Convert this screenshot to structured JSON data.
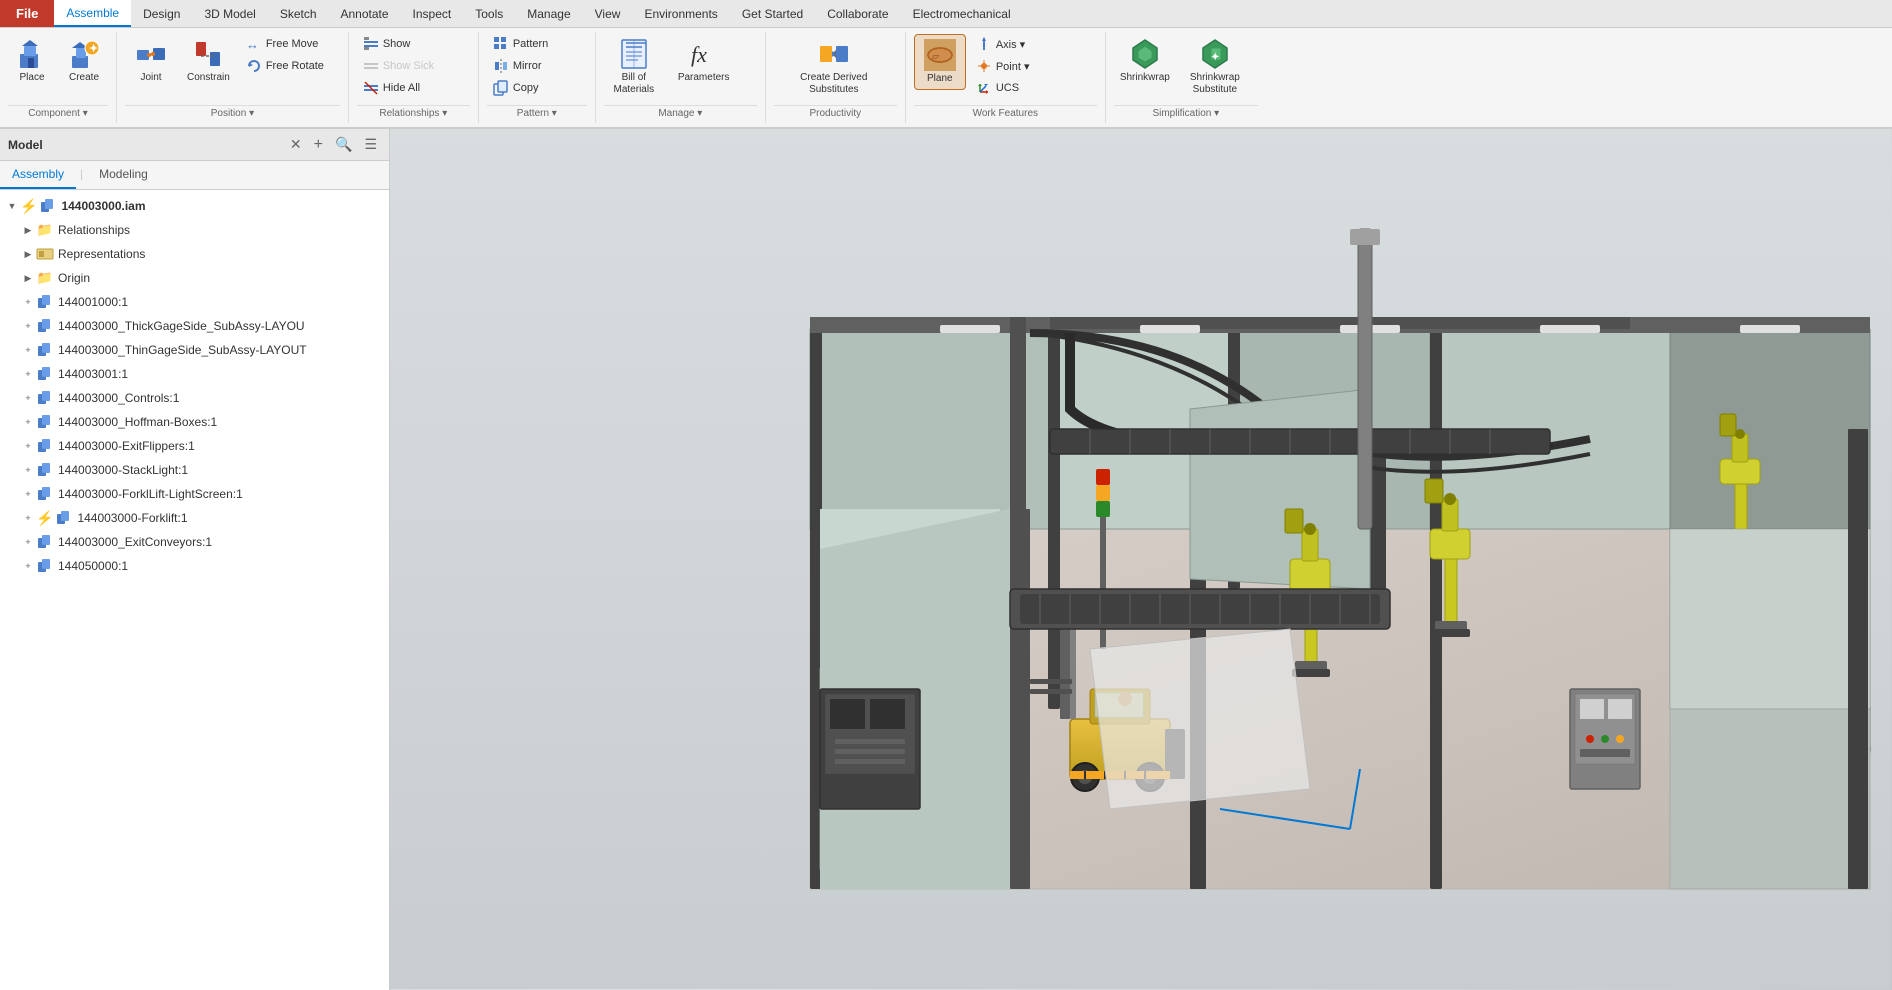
{
  "menubar": {
    "file": "File",
    "tabs": [
      "Assemble",
      "Design",
      "3D Model",
      "Sketch",
      "Annotate",
      "Inspect",
      "Tools",
      "Manage",
      "View",
      "Environments",
      "Get Started",
      "Collaborate",
      "Electromechanical"
    ]
  },
  "ribbon": {
    "groups": {
      "component": {
        "label": "Component ▾",
        "buttons": [
          {
            "id": "place",
            "label": "Place",
            "icon": "📦"
          },
          {
            "id": "create",
            "label": "Create",
            "icon": "✨"
          }
        ]
      },
      "position": {
        "label": "Position ▾",
        "buttons": [
          {
            "id": "free-move",
            "label": "Free Move",
            "icon": "↔"
          },
          {
            "id": "free-rotate",
            "label": "Free Rotate",
            "icon": "🔄"
          },
          {
            "id": "joint",
            "label": "Joint",
            "icon": "🔗"
          },
          {
            "id": "constrain",
            "label": "Constrain",
            "icon": "📐"
          }
        ]
      },
      "relationships": {
        "label": "Relationships ▾",
        "buttons": [
          {
            "id": "show",
            "label": "Show",
            "icon": "👁"
          },
          {
            "id": "show-sick",
            "label": "Show Sick",
            "icon": "⚠"
          },
          {
            "id": "hide-all",
            "label": "Hide All",
            "icon": "🚫"
          }
        ]
      },
      "pattern": {
        "label": "Pattern ▾",
        "buttons": [
          {
            "id": "pattern",
            "label": "Pattern",
            "icon": "⊞"
          },
          {
            "id": "mirror",
            "label": "Mirror",
            "icon": "⧢"
          },
          {
            "id": "copy",
            "label": "Copy",
            "icon": "⎘"
          }
        ]
      },
      "manage": {
        "label": "Manage ▾",
        "buttons": [
          {
            "id": "bill-of-materials",
            "label": "Bill of\nMaterials",
            "icon": "📋"
          },
          {
            "id": "parameters",
            "label": "Parameters",
            "icon": "𝑓𝑥"
          }
        ]
      },
      "productivity": {
        "label": "Productivity",
        "buttons": [
          {
            "id": "create-derived-substitutes",
            "label": "Create Derived\nSubstitutes",
            "icon": "🔀"
          }
        ]
      },
      "work-features": {
        "label": "Work Features",
        "buttons": [
          {
            "id": "plane",
            "label": "Plane",
            "icon": "▭"
          },
          {
            "id": "axis",
            "label": "Axis ▾",
            "icon": "⟋"
          },
          {
            "id": "point",
            "label": "Point ▾",
            "icon": "•"
          },
          {
            "id": "ucs",
            "label": "UCS",
            "icon": "⌖"
          }
        ]
      },
      "simplification": {
        "label": "Simplification ▾",
        "buttons": [
          {
            "id": "shrinkwrap",
            "label": "Shrinkwrap",
            "icon": "⬡"
          },
          {
            "id": "shrinkwrap-substitute",
            "label": "Shrinkwrap\nSubstitute",
            "icon": "⬢"
          }
        ]
      }
    }
  },
  "panel": {
    "title": "Model",
    "tabs": [
      "Assembly",
      "Modeling"
    ],
    "tree_items": [
      {
        "id": "root",
        "label": "144003000.iam",
        "icon": "component",
        "bold": true,
        "lightning": true,
        "indent": 0
      },
      {
        "id": "relationships",
        "label": "Relationships",
        "icon": "folder-yellow",
        "indent": 1
      },
      {
        "id": "representations",
        "label": "Representations",
        "icon": "folder-special",
        "indent": 1
      },
      {
        "id": "origin",
        "label": "Origin",
        "icon": "folder-yellow",
        "indent": 1
      },
      {
        "id": "comp1",
        "label": "144001000:1",
        "icon": "component",
        "indent": 1
      },
      {
        "id": "comp2",
        "label": "144003000_ThickGageSide_SubAssy-LAYOU",
        "icon": "component",
        "indent": 1
      },
      {
        "id": "comp3",
        "label": "144003000_ThinGageSide_SubAssy-LAYOUT",
        "icon": "component",
        "indent": 1
      },
      {
        "id": "comp4",
        "label": "144003001:1",
        "icon": "component",
        "indent": 1
      },
      {
        "id": "comp5",
        "label": "144003000_Controls:1",
        "icon": "component",
        "indent": 1
      },
      {
        "id": "comp6",
        "label": "144003000_Hoffman-Boxes:1",
        "icon": "component",
        "indent": 1
      },
      {
        "id": "comp7",
        "label": "144003000-ExitFlippers:1",
        "icon": "component",
        "indent": 1
      },
      {
        "id": "comp8",
        "label": "144003000-StackLight:1",
        "icon": "component",
        "indent": 1
      },
      {
        "id": "comp9",
        "label": "144003000-ForklLift-LightScreen:1",
        "icon": "component",
        "indent": 1
      },
      {
        "id": "comp10",
        "label": "144003000-Forklift:1",
        "icon": "component",
        "lightning": true,
        "indent": 1
      },
      {
        "id": "comp11",
        "label": "144003000_ExitConveyors:1",
        "icon": "component",
        "indent": 1
      },
      {
        "id": "comp12",
        "label": "144050000:1",
        "icon": "component",
        "indent": 1
      }
    ]
  },
  "viewport": {
    "description": "3D Assembly View - Factory Floor"
  }
}
